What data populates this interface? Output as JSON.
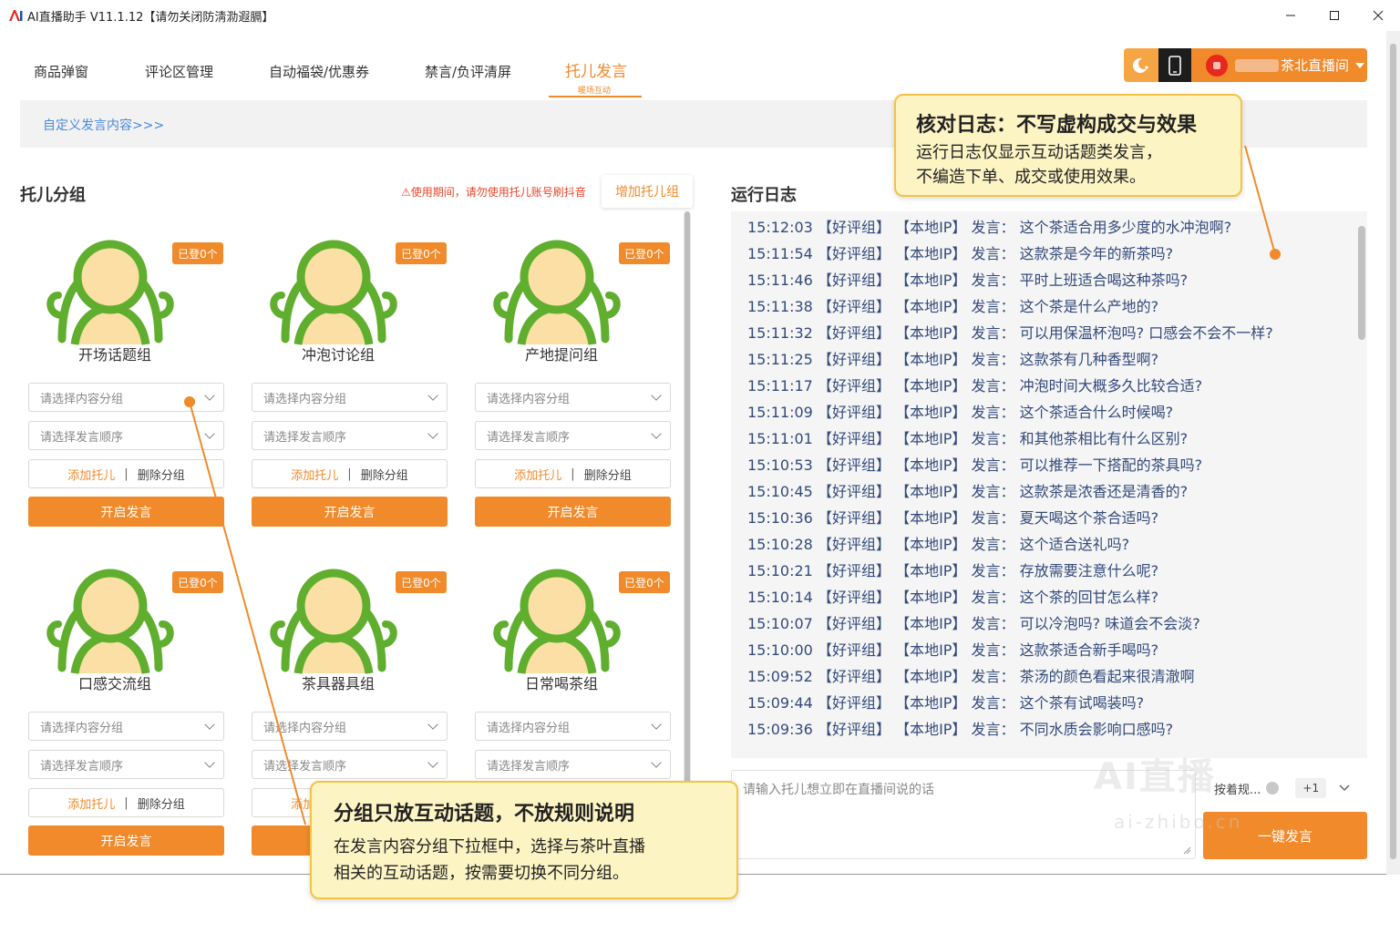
{
  "window": {
    "title": "AI直播助手 V11.1.12【请勿关闭防淸泐遐膈】",
    "controls": [
      "minimize",
      "maximize",
      "close"
    ]
  },
  "tabs": [
    {
      "label": "商品弹窗"
    },
    {
      "label": "评论区管理"
    },
    {
      "label": "自动福袋/优惠券"
    },
    {
      "label": "禁言/负评清屏"
    },
    {
      "label": "托儿发言",
      "sub": "暖场互动",
      "active": true
    }
  ],
  "header_right": {
    "icon1": "moon-toggle-icon",
    "icon2": "phone-icon",
    "live_room": "茶北直播间"
  },
  "custom_link": "自定义发言内容>>>",
  "left": {
    "title": "托儿分组",
    "warning": "⚠使用期间，请勿使用托儿账号刷抖音",
    "add_group": "增加托儿组",
    "groups": [
      {
        "name": "开场话题组",
        "badge": "已登0个"
      },
      {
        "name": "冲泡讨论组",
        "badge": "已登0个"
      },
      {
        "name": "产地提问组",
        "badge": "已登0个"
      },
      {
        "name": "口感交流组",
        "badge": "已登0个"
      },
      {
        "name": "茶具器具组",
        "badge": "已登0个"
      },
      {
        "name": "日常喝茶组",
        "badge": "已登0个"
      }
    ],
    "content_placeholder": "请选择内容分组",
    "order_placeholder": "请选择发言顺序",
    "add_tuoer": "添加托儿",
    "separator": "|",
    "delete_group": "删除分组",
    "start_speaking": "开启发言"
  },
  "log": {
    "title": "运行日志",
    "entries": [
      {
        "time": "15:12:03",
        "group": "【好评组】",
        "ip": "【本地IP】",
        "label": "发言：",
        "text": "这个茶适合用多少度的水冲泡啊?"
      },
      {
        "time": "15:11:54",
        "group": "【好评组】",
        "ip": "【本地IP】",
        "label": "发言：",
        "text": "这款茶是今年的新茶吗?"
      },
      {
        "time": "15:11:46",
        "group": "【好评组】",
        "ip": "【本地IP】",
        "label": "发言：",
        "text": "平时上班适合喝这种茶吗?"
      },
      {
        "time": "15:11:38",
        "group": "【好评组】",
        "ip": "【本地IP】",
        "label": "发言：",
        "text": "这个茶是什么产地的?"
      },
      {
        "time": "15:11:32",
        "group": "【好评组】",
        "ip": "【本地IP】",
        "label": "发言：",
        "text": "可以用保温杯泡吗? 口感会不会不一样?"
      },
      {
        "time": "15:11:25",
        "group": "【好评组】",
        "ip": "【本地IP】",
        "label": "发言：",
        "text": "这款茶有几种香型啊?"
      },
      {
        "time": "15:11:17",
        "group": "【好评组】",
        "ip": "【本地IP】",
        "label": "发言：",
        "text": "冲泡时间大概多久比较合适?"
      },
      {
        "time": "15:11:09",
        "group": "【好评组】",
        "ip": "【本地IP】",
        "label": "发言：",
        "text": "这个茶适合什么时候喝?"
      },
      {
        "time": "15:11:01",
        "group": "【好评组】",
        "ip": "【本地IP】",
        "label": "发言：",
        "text": "和其他茶相比有什么区别?"
      },
      {
        "time": "15:10:53",
        "group": "【好评组】",
        "ip": "【本地IP】",
        "label": "发言：",
        "text": "可以推荐一下搭配的茶具吗?"
      },
      {
        "time": "15:10:45",
        "group": "【好评组】",
        "ip": "【本地IP】",
        "label": "发言：",
        "text": "这款茶是浓香还是清香的?"
      },
      {
        "time": "15:10:36",
        "group": "【好评组】",
        "ip": "【本地IP】",
        "label": "发言：",
        "text": "夏天喝这个茶合适吗?"
      },
      {
        "time": "15:10:28",
        "group": "【好评组】",
        "ip": "【本地IP】",
        "label": "发言：",
        "text": "这个适合送礼吗?"
      },
      {
        "time": "15:10:21",
        "group": "【好评组】",
        "ip": "【本地IP】",
        "label": "发言：",
        "text": "存放需要注意什么呢?"
      },
      {
        "time": "15:10:14",
        "group": "【好评组】",
        "ip": "【本地IP】",
        "label": "发言：",
        "text": "这个茶的回甘怎么样?"
      },
      {
        "time": "15:10:07",
        "group": "【好评组】",
        "ip": "【本地IP】",
        "label": "发言：",
        "text": "可以冷泡吗? 味道会不会淡?"
      },
      {
        "time": "15:10:00",
        "group": "【好评组】",
        "ip": "【本地IP】",
        "label": "发言：",
        "text": "这款茶适合新手喝吗?"
      },
      {
        "time": "15:09:52",
        "group": "【好评组】",
        "ip": "【本地IP】",
        "label": "发言：",
        "text": "茶汤的颜色看起来很清澈啊"
      },
      {
        "time": "15:09:44",
        "group": "【好评组】",
        "ip": "【本地IP】",
        "label": "发言：",
        "text": "这个茶有试喝装吗?"
      },
      {
        "time": "15:09:36",
        "group": "【好评组】",
        "ip": "【本地IP】",
        "label": "发言：",
        "text": "不同水质会影响口感吗?"
      }
    ],
    "input_placeholder": "请输入托儿想立即在直播间说的话",
    "order_value": "按着规...",
    "order_more": "+1",
    "send_button": "一键发言"
  },
  "callouts": {
    "top": {
      "title": "核对日志：不写虚构成交与效果",
      "line1": "运行日志仅显示互动话题类发言，",
      "line2": "不编造下单、成交或使用效果。"
    },
    "bottom": {
      "title": "分组只放互动话题，不放规则说明",
      "line1": "在发言内容分组下拉框中，选择与茶叶直播",
      "line2": "相关的互动话题，按需要切换不同分组。"
    }
  },
  "watermark": {
    "main": "AI直播",
    "url": "ai-zhibo.cn"
  },
  "colors": {
    "accent": "#f08a2a",
    "avatar_green": "#5fae2e",
    "avatar_face": "#fbdfa4",
    "log_text": "#334a7a",
    "callout_bg": "#fdf4c4",
    "callout_border": "#f2c344",
    "warning": "#e8452a"
  }
}
